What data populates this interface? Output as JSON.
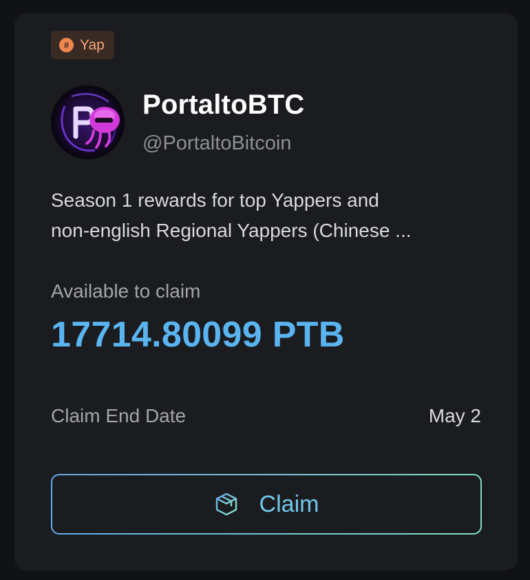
{
  "tag": {
    "icon": "hash-icon",
    "label": "Yap"
  },
  "profile": {
    "avatar_icon": "portal-jellyfish-avatar",
    "name": "PortaltoBTC",
    "handle": "@PortaltoBitcoin"
  },
  "description_line1": "Season 1 rewards for top Yappers and",
  "description_line2": "non-english Regional Yappers (Chinese ...",
  "claim_info": {
    "available_label": "Available to claim",
    "amount": "17714.80099 PTB",
    "end_date_label": "Claim End Date",
    "end_date_value": "May 2"
  },
  "claim_button": {
    "icon": "box-icon",
    "label": "Claim"
  },
  "colors": {
    "amount": "#5ab4f0",
    "tag_bg": "#3a2a24",
    "tag_text": "#f6a77a",
    "button_gradient_start": "#6aa9e8",
    "button_gradient_end": "#84e0c4"
  }
}
